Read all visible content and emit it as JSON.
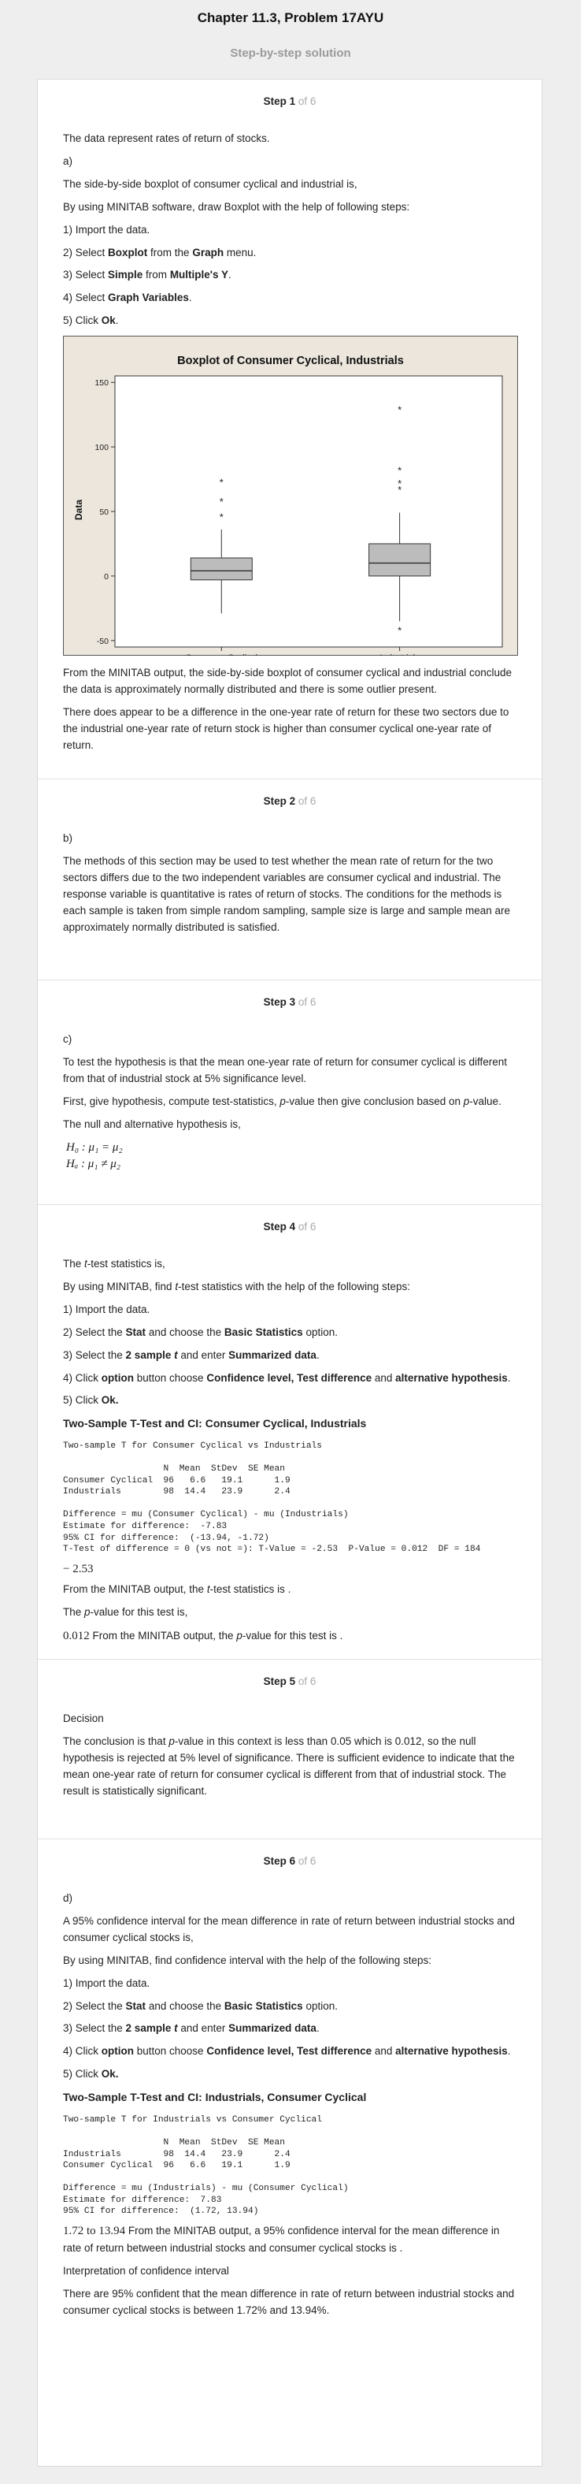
{
  "header": {
    "title": "Chapter 11.3, Problem 17AYU",
    "subtitle": "Step-by-step solution"
  },
  "steps": [
    {
      "step_label": "Step 1",
      "of_label": "of 6"
    },
    {
      "step_label": "Step 2",
      "of_label": "of 6"
    },
    {
      "step_label": "Step 3",
      "of_label": "of 6"
    },
    {
      "step_label": "Step 4",
      "of_label": "of 6"
    },
    {
      "step_label": "Step 5",
      "of_label": "of 6"
    },
    {
      "step_label": "Step 6",
      "of_label": "of 6"
    }
  ],
  "step1": {
    "intro": "The data represent rates of return of stocks.",
    "part": "a)",
    "l1": "The side-by-side boxplot of consumer cyclical and industrial is,",
    "l2": "By using MINITAB software, draw Boxplot with the help of following steps:",
    "s1": "1) Import the data.",
    "s2a": "2) Select ",
    "s2b": "Boxplot",
    "s2c": " from the ",
    "s2d": "Graph",
    "s2e": " menu.",
    "s3a": "3) Select ",
    "s3b": "Simple",
    "s3c": " from ",
    "s3d": "Multiple's Y",
    "s3e": ".",
    "s4a": "4) Select ",
    "s4b": "Graph Variables",
    "s4c": ".",
    "s5a": "5) Click ",
    "s5b": "Ok",
    "s5c": ".",
    "after1": "From the MINITAB output, the side-by-side boxplot of consumer cyclical and industrial conclude the data is approximately normally distributed and there is some outlier present.",
    "after2": "There does appear to be a difference in the one-year rate of return for these two sectors due to the industrial one-year rate of return stock is higher than consumer cyclical one-year rate of return."
  },
  "chart_data": {
    "type": "boxplot",
    "title": "Boxplot of Consumer Cyclical, Industrials",
    "ylabel": "Data",
    "xlabel": "",
    "ylim": [
      -55,
      155
    ],
    "yticks": [
      -50,
      0,
      50,
      100,
      150
    ],
    "categories": [
      "Consumer Cyclical",
      "Industrials"
    ],
    "series": [
      {
        "q1": -3,
        "median": 4,
        "q3": 14,
        "whisker_low": -29,
        "whisker_high": 36,
        "outliers": [
          73,
          58,
          46
        ]
      },
      {
        "q1": 0,
        "median": 10,
        "q3": 25,
        "whisker_low": -35,
        "whisker_high": 49,
        "outliers": [
          129,
          82,
          72,
          67,
          -42
        ]
      }
    ],
    "colors": {
      "box": "#bcbcbc",
      "plot_bg": "#ffffff",
      "panel_bg": "#ece6dc"
    }
  },
  "step2": {
    "part": "b)",
    "text": "The methods of this section may be used to test whether the mean rate of return for the two sectors differs due to the two independent variables are consumer cyclical and industrial. The response variable is quantitative is rates of return of stocks. The conditions for the methods is each sample is taken from simple random sampling, sample size is large and sample mean are approximately normally distributed is satisfied."
  },
  "step3": {
    "part": "c)",
    "l1": "To test the hypothesis is that the mean one-year rate of return for consumer cyclical is different from that of industrial stock at 5% significance level.",
    "l2a": "First, give hypothesis, compute test-statistics, ",
    "l2b": "p",
    "l2c": "-value then give conclusion based on ",
    "l2d": "p",
    "l2e": "-value.",
    "l3": "The null and alternative hypothesis is,",
    "h0": "H₀ : μ₁ = μ₂",
    "ha": "Hₐ : μ₁ ≠ μ₂"
  },
  "step4": {
    "l1a": "The ",
    "l1b": "t",
    "l1c": "-test statistics is,",
    "l2a": "By using MINITAB, find ",
    "l2b": "t",
    "l2c": "-test statistics with the help of the following steps:",
    "s1": "1) Import the data.",
    "s2a": "2) Select the ",
    "s2b": "Stat",
    "s2c": " and choose the ",
    "s2d": "Basic Statistics",
    "s2e": " option.",
    "s3a": "3) Select the ",
    "s3b": "2 sample ",
    "s3c": "t",
    "s3d": " and enter ",
    "s3e": "Summarized data",
    "s3f": ".",
    "s4a": "4) Click ",
    "s4b": "option",
    "s4c": " button choose ",
    "s4d": "Confidence level, Test difference",
    "s4e": " and ",
    "s4f": "alternative hypothesis",
    "s4g": ".",
    "s5a": "5) Click ",
    "s5b": "Ok.",
    "mtitle": "Two-Sample T-Test and CI: Consumer Cyclical, Industrials",
    "mout": "Two-sample T for Consumer Cyclical vs Industrials\n\n                   N  Mean  StDev  SE Mean\nConsumer Cyclical  96   6.6   19.1      1.9\nIndustrials        98  14.4   23.9      2.4\n\nDifference = mu (Consumer Cyclical) - mu (Industrials)\nEstimate for difference:  -7.83\n95% CI for difference:  (-13.94, -1.72)\nT-Test of difference = 0 (vs not =): T-Value = -2.53  P-Value = 0.012  DF = 184",
    "tval": "− 2.53",
    "l3a": "From the MINITAB output, the ",
    "l3b": "t",
    "l3c": "-test statistics is .",
    "l4a": "The ",
    "l4b": "p",
    "l4c": "-value for this test is,",
    "pval": "0.012",
    "l5a": " From the MINITAB output, the ",
    "l5b": "p",
    "l5c": "-value for this test is ."
  },
  "step5": {
    "heading": "Decision",
    "ta": "The conclusion is that ",
    "tb": "p",
    "tc": "-value in this context is less than 0.05 which is 0.012, so the null hypothesis is rejected at 5% level of significance. There is sufficient evidence to indicate that the mean one-year rate of return for consumer cyclical is different from that of industrial stock. The result is statistically significant."
  },
  "step6": {
    "part": "d)",
    "l1": "A 95% confidence interval for the mean difference in rate of return between industrial stocks and consumer cyclical stocks is,",
    "l2": "By using MINITAB, find confidence interval with the help of the following steps:",
    "s1": "1) Import the data.",
    "s2a": "2) Select the ",
    "s2b": "Stat",
    "s2c": " and choose the ",
    "s2d": "Basic Statistics",
    "s2e": " option.",
    "s3a": "3) Select the ",
    "s3b": "2 sample ",
    "s3c": "t",
    "s3d": " and enter ",
    "s3e": "Summarized data",
    "s3f": ".",
    "s4a": "4) Click ",
    "s4b": "option",
    "s4c": " button choose ",
    "s4d": "Confidence level, Test difference",
    "s4e": " and ",
    "s4f": "alternative hypothesis",
    "s4g": ".",
    "s5a": "5) Click ",
    "s5b": "Ok.",
    "mtitle": "Two-Sample T-Test and CI: Industrials, Consumer Cyclical",
    "mout": "Two-sample T for Industrials vs Consumer Cyclical\n\n                   N  Mean  StDev  SE Mean\nIndustrials        98  14.4   23.9      2.4\nConsumer Cyclical  96   6.6   19.1      1.9\n\nDifference = mu (Industrials) - mu (Consumer Cyclical)\nEstimate for difference:  7.83\n95% CI for difference:  (1.72, 13.94)",
    "ci": "1.72 to 13.94",
    "l3": " From the MINITAB output, a 95% confidence interval for the mean difference in rate of return between industrial stocks and consumer cyclical stocks is .",
    "l4": "Interpretation of confidence interval",
    "l5": "There are 95% confident that the mean difference in rate of return between industrial stocks and consumer cyclical stocks is between 1.72% and 13.94%."
  }
}
